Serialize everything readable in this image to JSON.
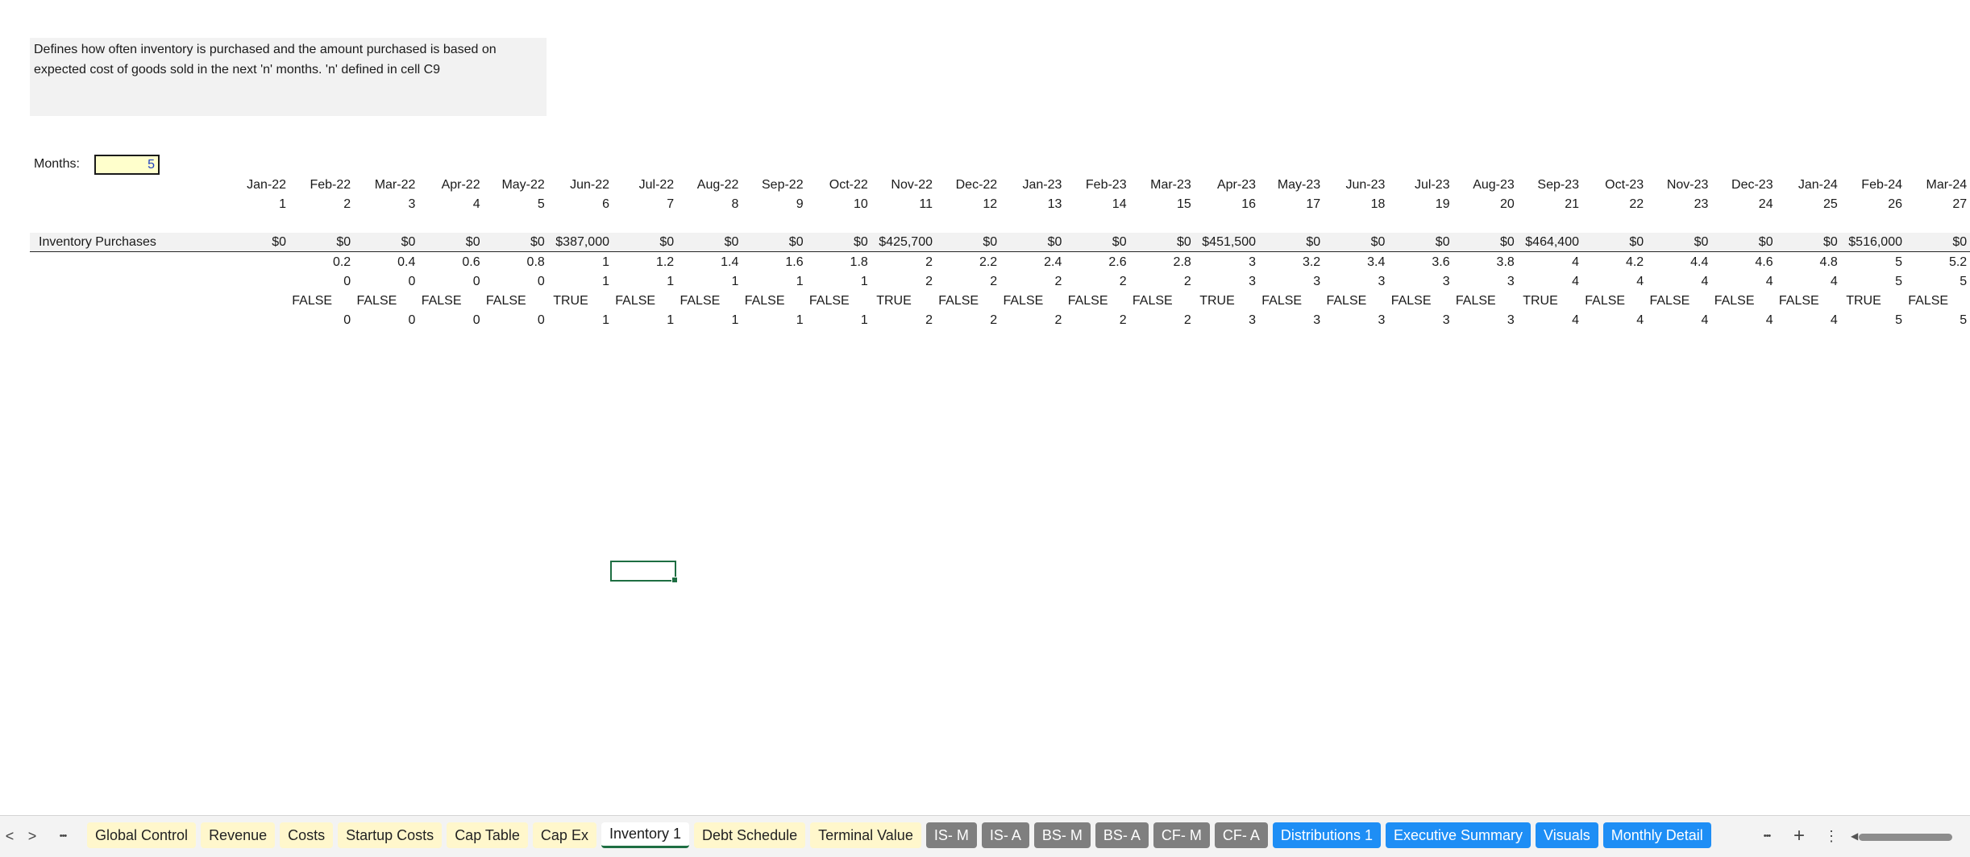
{
  "note": "Defines how often inventory is purchased and the amount purchased is based on\nexpected cost of goods sold in the next 'n' months. 'n' defined in cell C9",
  "months": {
    "label": "Months:",
    "value": "5"
  },
  "row_label": "Inventory Purchases",
  "first_col": {
    "purchase": "$0"
  },
  "columns": [
    {
      "m": "Jan-22",
      "i": "1",
      "p": "$0",
      "r1": "",
      "r2": "",
      "r3": "",
      "r4": ""
    },
    {
      "m": "Feb-22",
      "i": "2",
      "p": "$0",
      "r1": "0.2",
      "r2": "0",
      "r3": "FALSE",
      "r4": "0"
    },
    {
      "m": "Mar-22",
      "i": "3",
      "p": "$0",
      "r1": "0.4",
      "r2": "0",
      "r3": "FALSE",
      "r4": "0"
    },
    {
      "m": "Apr-22",
      "i": "4",
      "p": "$0",
      "r1": "0.6",
      "r2": "0",
      "r3": "FALSE",
      "r4": "0"
    },
    {
      "m": "May-22",
      "i": "5",
      "p": "$0",
      "r1": "0.8",
      "r2": "0",
      "r3": "FALSE",
      "r4": "0"
    },
    {
      "m": "Jun-22",
      "i": "6",
      "p": "$387,000",
      "r1": "1",
      "r2": "1",
      "r3": "TRUE",
      "r4": "1"
    },
    {
      "m": "Jul-22",
      "i": "7",
      "p": "$0",
      "r1": "1.2",
      "r2": "1",
      "r3": "FALSE",
      "r4": "1"
    },
    {
      "m": "Aug-22",
      "i": "8",
      "p": "$0",
      "r1": "1.4",
      "r2": "1",
      "r3": "FALSE",
      "r4": "1"
    },
    {
      "m": "Sep-22",
      "i": "9",
      "p": "$0",
      "r1": "1.6",
      "r2": "1",
      "r3": "FALSE",
      "r4": "1"
    },
    {
      "m": "Oct-22",
      "i": "10",
      "p": "$0",
      "r1": "1.8",
      "r2": "1",
      "r3": "FALSE",
      "r4": "1"
    },
    {
      "m": "Nov-22",
      "i": "11",
      "p": "$425,700",
      "r1": "2",
      "r2": "2",
      "r3": "TRUE",
      "r4": "2"
    },
    {
      "m": "Dec-22",
      "i": "12",
      "p": "$0",
      "r1": "2.2",
      "r2": "2",
      "r3": "FALSE",
      "r4": "2"
    },
    {
      "m": "Jan-23",
      "i": "13",
      "p": "$0",
      "r1": "2.4",
      "r2": "2",
      "r3": "FALSE",
      "r4": "2"
    },
    {
      "m": "Feb-23",
      "i": "14",
      "p": "$0",
      "r1": "2.6",
      "r2": "2",
      "r3": "FALSE",
      "r4": "2"
    },
    {
      "m": "Mar-23",
      "i": "15",
      "p": "$0",
      "r1": "2.8",
      "r2": "2",
      "r3": "FALSE",
      "r4": "2"
    },
    {
      "m": "Apr-23",
      "i": "16",
      "p": "$451,500",
      "r1": "3",
      "r2": "3",
      "r3": "TRUE",
      "r4": "3"
    },
    {
      "m": "May-23",
      "i": "17",
      "p": "$0",
      "r1": "3.2",
      "r2": "3",
      "r3": "FALSE",
      "r4": "3"
    },
    {
      "m": "Jun-23",
      "i": "18",
      "p": "$0",
      "r1": "3.4",
      "r2": "3",
      "r3": "FALSE",
      "r4": "3"
    },
    {
      "m": "Jul-23",
      "i": "19",
      "p": "$0",
      "r1": "3.6",
      "r2": "3",
      "r3": "FALSE",
      "r4": "3"
    },
    {
      "m": "Aug-23",
      "i": "20",
      "p": "$0",
      "r1": "3.8",
      "r2": "3",
      "r3": "FALSE",
      "r4": "3"
    },
    {
      "m": "Sep-23",
      "i": "21",
      "p": "$464,400",
      "r1": "4",
      "r2": "4",
      "r3": "TRUE",
      "r4": "4"
    },
    {
      "m": "Oct-23",
      "i": "22",
      "p": "$0",
      "r1": "4.2",
      "r2": "4",
      "r3": "FALSE",
      "r4": "4"
    },
    {
      "m": "Nov-23",
      "i": "23",
      "p": "$0",
      "r1": "4.4",
      "r2": "4",
      "r3": "FALSE",
      "r4": "4"
    },
    {
      "m": "Dec-23",
      "i": "24",
      "p": "$0",
      "r1": "4.6",
      "r2": "4",
      "r3": "FALSE",
      "r4": "4"
    },
    {
      "m": "Jan-24",
      "i": "25",
      "p": "$0",
      "r1": "4.8",
      "r2": "4",
      "r3": "FALSE",
      "r4": "4"
    },
    {
      "m": "Feb-24",
      "i": "26",
      "p": "$516,000",
      "r1": "5",
      "r2": "5",
      "r3": "TRUE",
      "r4": "5"
    },
    {
      "m": "Mar-24",
      "i": "27",
      "p": "$0",
      "r1": "5.2",
      "r2": "5",
      "r3": "FALSE",
      "r4": "5"
    }
  ],
  "tabbar": {
    "prev": "<",
    "next": ">",
    "more_left": "•••",
    "more_right": "•••",
    "add": "+",
    "options": "⋮",
    "tabs": [
      {
        "label": "Global Control",
        "style": "yellow"
      },
      {
        "label": "Revenue",
        "style": "yellow"
      },
      {
        "label": "Costs",
        "style": "yellow"
      },
      {
        "label": "Startup Costs",
        "style": "yellow"
      },
      {
        "label": "Cap Table",
        "style": "yellow"
      },
      {
        "label": "Cap Ex",
        "style": "yellow"
      },
      {
        "label": "Inventory 1",
        "style": "active"
      },
      {
        "label": "Debt Schedule",
        "style": "yellow"
      },
      {
        "label": "Terminal Value",
        "style": "yellow"
      },
      {
        "label": "IS- M",
        "style": "gray"
      },
      {
        "label": "IS- A",
        "style": "gray"
      },
      {
        "label": "BS- M",
        "style": "gray"
      },
      {
        "label": "BS- A",
        "style": "gray"
      },
      {
        "label": "CF- M",
        "style": "gray"
      },
      {
        "label": "CF- A",
        "style": "gray"
      },
      {
        "label": "Distributions 1",
        "style": "blue"
      },
      {
        "label": "Executive Summary",
        "style": "blue"
      },
      {
        "label": "Visuals",
        "style": "blue"
      },
      {
        "label": "Monthly Detail",
        "style": "blue"
      }
    ]
  }
}
